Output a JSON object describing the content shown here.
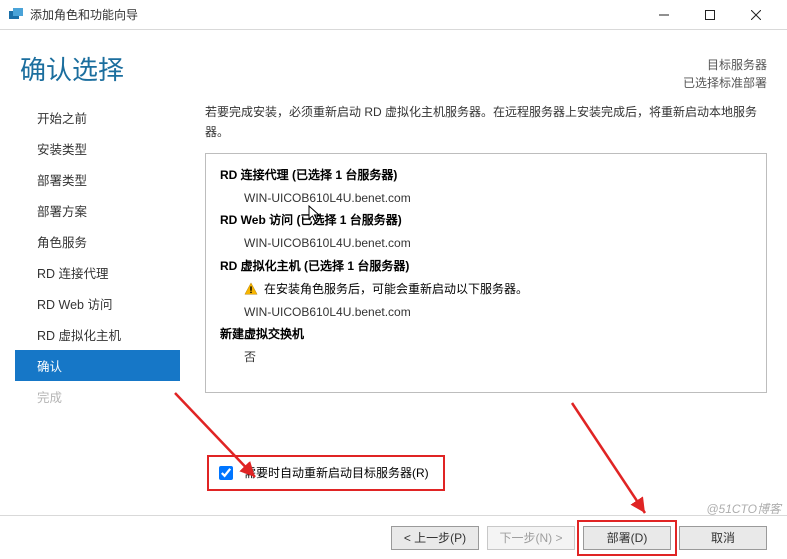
{
  "window": {
    "title": "添加角色和功能向导"
  },
  "header": {
    "page_title": "确认选择",
    "target_label": "目标服务器",
    "target_sub": "已选择标准部署"
  },
  "sidebar": {
    "items": [
      {
        "label": "开始之前",
        "state": "enabled"
      },
      {
        "label": "安装类型",
        "state": "enabled"
      },
      {
        "label": "部署类型",
        "state": "enabled"
      },
      {
        "label": "部署方案",
        "state": "enabled"
      },
      {
        "label": "角色服务",
        "state": "enabled"
      },
      {
        "label": "RD 连接代理",
        "state": "enabled"
      },
      {
        "label": "RD Web 访问",
        "state": "enabled"
      },
      {
        "label": "RD 虚拟化主机",
        "state": "enabled"
      },
      {
        "label": "确认",
        "state": "active"
      },
      {
        "label": "完成",
        "state": "disabled"
      }
    ]
  },
  "content": {
    "instruction": "若要完成安装，必须重新启动 RD 虚拟化主机服务器。在远程服务器上安装完成后，将重新启动本地服务器。",
    "roles": [
      {
        "title": "RD 连接代理  (已选择 1 台服务器)",
        "lines": [
          "WIN-UICOB610L4U.benet.com"
        ]
      },
      {
        "title": "RD Web 访问  (已选择 1 台服务器)",
        "lines": [
          "WIN-UICOB610L4U.benet.com"
        ]
      },
      {
        "title": "RD 虚拟化主机  (已选择 1 台服务器)",
        "warn": "在安装角色服务后，可能会重新启动以下服务器。",
        "lines": [
          "WIN-UICOB610L4U.benet.com"
        ]
      },
      {
        "title": "新建虚拟交换机",
        "lines": [
          "否"
        ]
      }
    ],
    "checkbox": {
      "checked": true,
      "label": "需要时自动重新启动目标服务器(R)"
    }
  },
  "buttons": {
    "prev": "< 上一步(P)",
    "next": "下一步(N) >",
    "deploy": "部署(D)",
    "cancel": "取消"
  },
  "watermark": "@51CTO博客"
}
